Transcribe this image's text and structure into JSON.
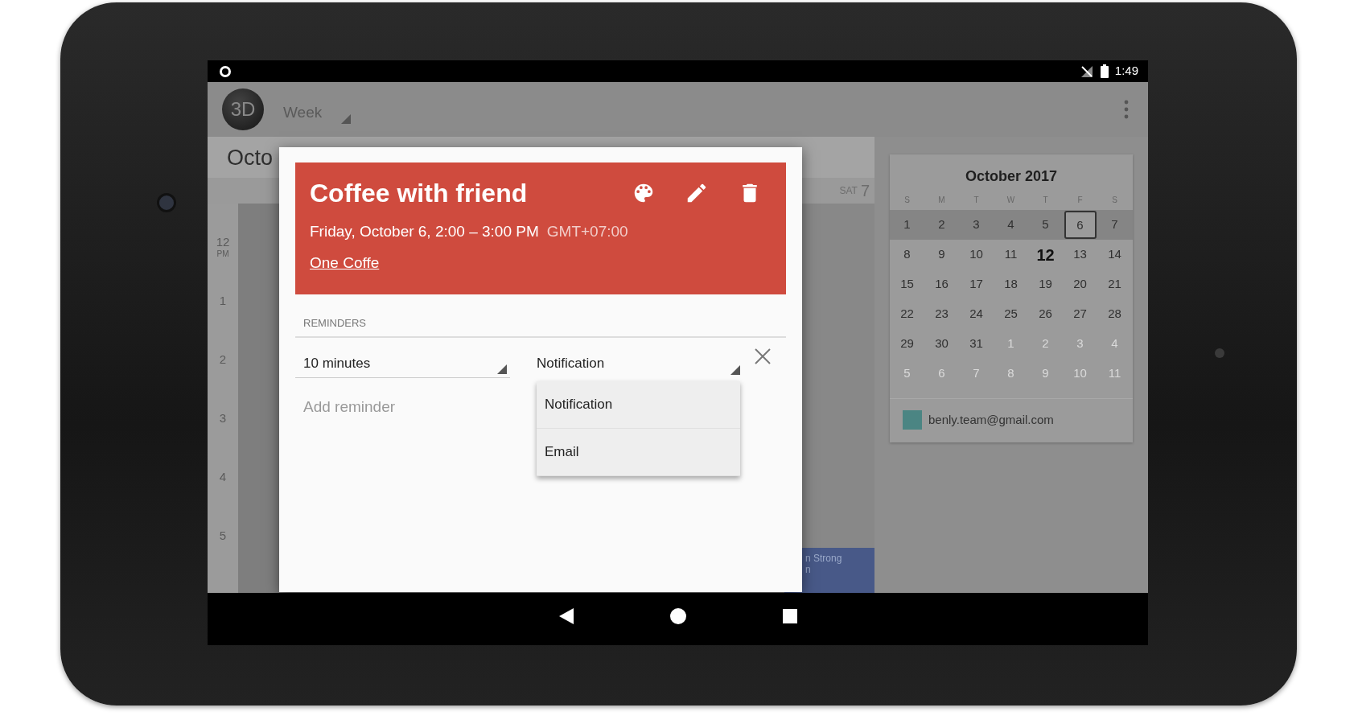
{
  "status_bar": {
    "time": "1:49"
  },
  "app_bar": {
    "avatar": "3D",
    "view": "Week"
  },
  "week_view": {
    "month_label": "Octo",
    "day_header": {
      "weekday": "SAT",
      "day": "7"
    },
    "hours": [
      {
        "hour": "12",
        "period": "PM"
      },
      {
        "hour": "1"
      },
      {
        "hour": "2"
      },
      {
        "hour": "3"
      },
      {
        "hour": "4"
      },
      {
        "hour": "5"
      }
    ],
    "event_fragment": [
      "n Strong",
      "n"
    ]
  },
  "dialog": {
    "title": "Coffee with friend",
    "when": "Friday, October 6, 2:00 – 3:00 PM",
    "timezone": "GMT+07:00",
    "location": "One Coffe",
    "reminders_label": "REMINDERS",
    "reminders": [
      {
        "time": "10 minutes",
        "method": "Notification"
      }
    ],
    "add_reminder": "Add reminder",
    "method_menu": [
      "Notification",
      "Email"
    ]
  },
  "mini_calendar": {
    "title": "October 2017",
    "weekdays": [
      "S",
      "M",
      "T",
      "W",
      "T",
      "F",
      "S"
    ],
    "weeks": [
      {
        "highlighted": true,
        "days": [
          {
            "day": "1",
            "outside": false,
            "selected": false,
            "today": false
          },
          {
            "day": "2",
            "outside": false,
            "selected": false,
            "today": false
          },
          {
            "day": "3",
            "outside": false,
            "selected": false,
            "today": false
          },
          {
            "day": "4",
            "outside": false,
            "selected": false,
            "today": false
          },
          {
            "day": "5",
            "outside": false,
            "selected": false,
            "today": false
          },
          {
            "day": "6",
            "outside": false,
            "selected": true,
            "today": false
          },
          {
            "day": "7",
            "outside": false,
            "selected": false,
            "today": false
          }
        ]
      },
      {
        "highlighted": false,
        "days": [
          {
            "day": "8",
            "outside": false,
            "selected": false,
            "today": false
          },
          {
            "day": "9",
            "outside": false,
            "selected": false,
            "today": false
          },
          {
            "day": "10",
            "outside": false,
            "selected": false,
            "today": false
          },
          {
            "day": "11",
            "outside": false,
            "selected": false,
            "today": false
          },
          {
            "day": "12",
            "outside": false,
            "selected": false,
            "today": true
          },
          {
            "day": "13",
            "outside": false,
            "selected": false,
            "today": false
          },
          {
            "day": "14",
            "outside": false,
            "selected": false,
            "today": false
          }
        ]
      },
      {
        "highlighted": false,
        "days": [
          {
            "day": "15",
            "outside": false,
            "selected": false,
            "today": false
          },
          {
            "day": "16",
            "outside": false,
            "selected": false,
            "today": false
          },
          {
            "day": "17",
            "outside": false,
            "selected": false,
            "today": false
          },
          {
            "day": "18",
            "outside": false,
            "selected": false,
            "today": false
          },
          {
            "day": "19",
            "outside": false,
            "selected": false,
            "today": false
          },
          {
            "day": "20",
            "outside": false,
            "selected": false,
            "today": false
          },
          {
            "day": "21",
            "outside": false,
            "selected": false,
            "today": false
          }
        ]
      },
      {
        "highlighted": false,
        "days": [
          {
            "day": "22",
            "outside": false,
            "selected": false,
            "today": false
          },
          {
            "day": "23",
            "outside": false,
            "selected": false,
            "today": false
          },
          {
            "day": "24",
            "outside": false,
            "selected": false,
            "today": false
          },
          {
            "day": "25",
            "outside": false,
            "selected": false,
            "today": false
          },
          {
            "day": "26",
            "outside": false,
            "selected": false,
            "today": false
          },
          {
            "day": "27",
            "outside": false,
            "selected": false,
            "today": false
          },
          {
            "day": "28",
            "outside": false,
            "selected": false,
            "today": false
          }
        ]
      },
      {
        "highlighted": false,
        "days": [
          {
            "day": "29",
            "outside": false,
            "selected": false,
            "today": false
          },
          {
            "day": "30",
            "outside": false,
            "selected": false,
            "today": false
          },
          {
            "day": "31",
            "outside": false,
            "selected": false,
            "today": false
          },
          {
            "day": "1",
            "outside": true,
            "selected": false,
            "today": false
          },
          {
            "day": "2",
            "outside": true,
            "selected": false,
            "today": false
          },
          {
            "day": "3",
            "outside": true,
            "selected": false,
            "today": false
          },
          {
            "day": "4",
            "outside": true,
            "selected": false,
            "today": false
          }
        ]
      },
      {
        "highlighted": false,
        "days": [
          {
            "day": "5",
            "outside": true,
            "selected": false,
            "today": false
          },
          {
            "day": "6",
            "outside": true,
            "selected": false,
            "today": false
          },
          {
            "day": "7",
            "outside": true,
            "selected": false,
            "today": false
          },
          {
            "day": "8",
            "outside": true,
            "selected": false,
            "today": false
          },
          {
            "day": "9",
            "outside": true,
            "selected": false,
            "today": false
          },
          {
            "day": "10",
            "outside": true,
            "selected": false,
            "today": false
          },
          {
            "day": "11",
            "outside": true,
            "selected": false,
            "today": false
          }
        ]
      }
    ]
  },
  "accounts": [
    {
      "email": "benly.team@gmail.com",
      "color": "#4b8583"
    }
  ]
}
